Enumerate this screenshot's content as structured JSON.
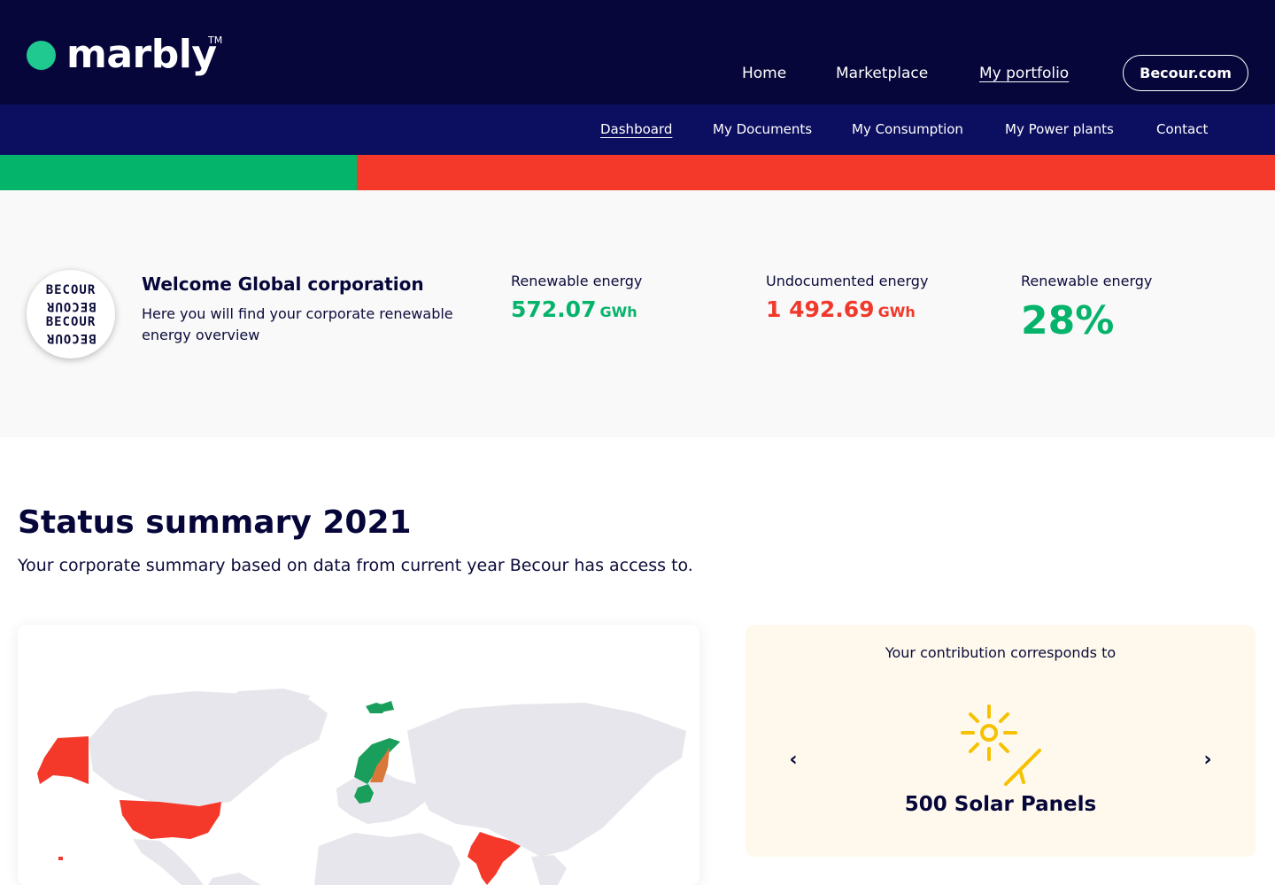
{
  "header": {
    "logo_text": "marbly",
    "logo_tm": "TM",
    "nav": [
      {
        "label": "Home",
        "active": false
      },
      {
        "label": "Marketplace",
        "active": false
      },
      {
        "label": "My portfolio",
        "active": true
      }
    ],
    "cta_label": "Becour.com"
  },
  "subnav": [
    {
      "label": "Dashboard",
      "active": true
    },
    {
      "label": "My Documents",
      "active": false
    },
    {
      "label": "My Consumption",
      "active": false
    },
    {
      "label": "My Power plants",
      "active": false
    },
    {
      "label": "Contact",
      "active": false
    }
  ],
  "progress": {
    "renewable_fraction": 0.28,
    "colors": {
      "renewable": "#04b46a",
      "undocumented": "#f4392b"
    }
  },
  "welcome": {
    "badge_lines": [
      "BECOUR",
      "BECOUR",
      "BECOUR",
      "BECOUR"
    ],
    "title": "Welcome Global corporation",
    "subtitle": "Here you will find your corporate renewable energy overview"
  },
  "stats": {
    "renewable": {
      "label": "Renewable energy",
      "value": "572.07",
      "unit": "GWh"
    },
    "undocumented": {
      "label": "Undocumented energy",
      "value": "1 492.69",
      "unit": "GWh"
    },
    "renewable_share": {
      "label": "Renewable energy",
      "value": "28%"
    }
  },
  "summary": {
    "title": "Status summary 2021",
    "subtitle": "Your corporate summary based on data from current year Becour has access to."
  },
  "map": {
    "highlighted_countries": [
      {
        "country": "United States",
        "status": "undocumented",
        "color": "#f4392b"
      },
      {
        "country": "India",
        "status": "undocumented",
        "color": "#f4392b"
      },
      {
        "country": "Norway",
        "status": "renewable",
        "color": "#1a9e5b"
      },
      {
        "country": "Sweden",
        "status": "mixed",
        "color": "#d9783a"
      },
      {
        "country": "Germany",
        "status": "renewable",
        "color": "#1a9e5b"
      }
    ]
  },
  "contribution": {
    "label": "Your contribution corresponds to",
    "value": "500 Solar Panels",
    "icon": "solar-panel-sun-icon",
    "prev_icon": "chevron-left-icon",
    "next_icon": "chevron-right-icon",
    "prev_glyph": "‹",
    "next_glyph": "›"
  }
}
